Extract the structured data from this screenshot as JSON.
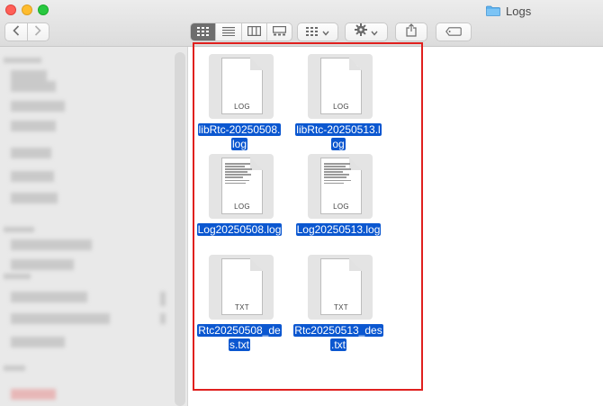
{
  "window": {
    "title": "Logs"
  },
  "toolbar": {
    "back_icon": "chevron-left-icon",
    "forward_icon": "chevron-right-icon",
    "views": [
      "icon-view",
      "list-view",
      "column-view",
      "gallery-view"
    ],
    "active_view": "icon-view"
  },
  "files": [
    {
      "name": "libRtc-20250508.log",
      "label_lines": [
        "libRtc-20250508.",
        "log"
      ],
      "ext": "LOG",
      "preview": false
    },
    {
      "name": "libRtc-20250513.log",
      "label_lines": [
        "libRtc-20250513.l",
        "og"
      ],
      "ext": "LOG",
      "preview": false
    },
    {
      "name": "Log20250508.log",
      "label_lines": [
        "Log20250508.log"
      ],
      "ext": "LOG",
      "preview": true
    },
    {
      "name": "Log20250513.log",
      "label_lines": [
        "Log20250513.log"
      ],
      "ext": "LOG",
      "preview": true
    },
    {
      "name": "Rtc20250508_des.txt",
      "label_lines": [
        "Rtc20250508_de",
        "s.txt"
      ],
      "ext": "TXT",
      "preview": false
    },
    {
      "name": "Rtc20250513_des.txt",
      "label_lines": [
        "Rtc20250513_des",
        ".txt"
      ],
      "ext": "TXT",
      "preview": false
    }
  ],
  "colors": {
    "selection": "#0b57d0",
    "highlight_border": "#e0201e",
    "sidebar_bg": "#e9e9e9"
  }
}
